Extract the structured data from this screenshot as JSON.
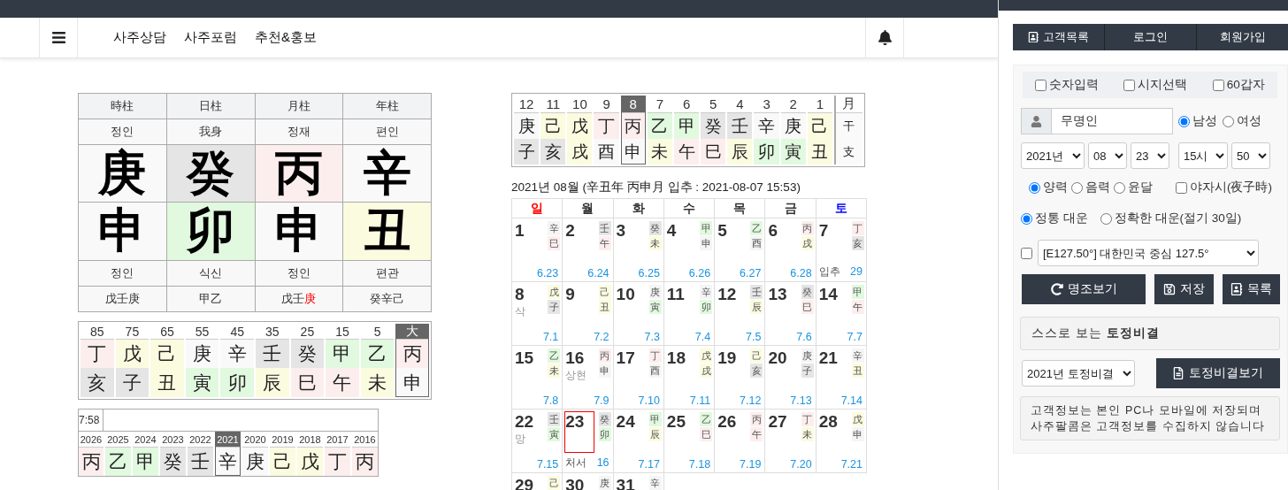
{
  "navbar": {
    "menu": [
      "사주상담",
      "사주포럼",
      "추천&홍보"
    ]
  },
  "pillars": {
    "columns": [
      {
        "title": "時柱",
        "top_role": "정인",
        "stem": {
          "char": "庚",
          "color": "#f9f9f9"
        },
        "branch": {
          "char": "申",
          "color": "#f9f9f9"
        },
        "bottom_role": "정인",
        "hidden": [
          {
            "text": "戊壬庚",
            "emphasis": false
          }
        ]
      },
      {
        "title": "日柱",
        "top_role": "我身",
        "stem": {
          "char": "癸",
          "color": "#e5e5e5"
        },
        "branch": {
          "char": "卯",
          "color": "#e1f9df"
        },
        "bottom_role": "식신",
        "hidden": [
          {
            "text": "甲乙",
            "emphasis": false
          }
        ]
      },
      {
        "title": "月柱",
        "top_role": "정재",
        "stem": {
          "char": "丙",
          "color": "#fdeeee"
        },
        "branch": {
          "char": "申",
          "color": "#f9f9f9"
        },
        "bottom_role": "정인",
        "hidden": [
          {
            "text": "戊壬",
            "emphasis": false
          },
          {
            "text": "庚",
            "emphasis": true
          }
        ]
      },
      {
        "title": "年柱",
        "top_role": "편인",
        "stem": {
          "char": "辛",
          "color": "#f9f9f9"
        },
        "branch": {
          "char": "丑",
          "color": "#fbfbe0"
        },
        "bottom_role": "편관",
        "hidden": [
          {
            "text": "癸辛己",
            "emphasis": false
          }
        ]
      }
    ]
  },
  "daewoon": [
    {
      "label": "85",
      "selected": false,
      "stem": {
        "char": "丁",
        "color": "#fdeeee"
      },
      "branch": {
        "char": "亥",
        "color": "#e5e5e5"
      }
    },
    {
      "label": "75",
      "selected": false,
      "stem": {
        "char": "戊",
        "color": "#fbfbe0"
      },
      "branch": {
        "char": "子",
        "color": "#e5e5e5"
      }
    },
    {
      "label": "65",
      "selected": false,
      "stem": {
        "char": "己",
        "color": "#fbfbe0"
      },
      "branch": {
        "char": "丑",
        "color": "#fbfbe0"
      }
    },
    {
      "label": "55",
      "selected": false,
      "stem": {
        "char": "庚",
        "color": "#f9f9f9"
      },
      "branch": {
        "char": "寅",
        "color": "#e1f9df"
      }
    },
    {
      "label": "45",
      "selected": false,
      "stem": {
        "char": "辛",
        "color": "#f9f9f9"
      },
      "branch": {
        "char": "卯",
        "color": "#e1f9df"
      }
    },
    {
      "label": "35",
      "selected": false,
      "stem": {
        "char": "壬",
        "color": "#e5e5e5"
      },
      "branch": {
        "char": "辰",
        "color": "#fbfbe0"
      }
    },
    {
      "label": "25",
      "selected": false,
      "stem": {
        "char": "癸",
        "color": "#e5e5e5"
      },
      "branch": {
        "char": "巳",
        "color": "#fdeeee"
      }
    },
    {
      "label": "15",
      "selected": false,
      "stem": {
        "char": "甲",
        "color": "#e1f9df"
      },
      "branch": {
        "char": "午",
        "color": "#fdeeee"
      }
    },
    {
      "label": "5",
      "selected": false,
      "stem": {
        "char": "乙",
        "color": "#e1f9df"
      },
      "branch": {
        "char": "未",
        "color": "#fbfbe0"
      }
    },
    {
      "label": "大",
      "selected": true,
      "stem": {
        "char": "丙",
        "color": "#fdeeee"
      },
      "branch": {
        "char": "申",
        "color": "#f9f9f9"
      }
    }
  ],
  "years": {
    "time": "7:58",
    "items": [
      {
        "label": "2026",
        "selected": false,
        "stem": {
          "char": "丙",
          "color": "#fdeeee"
        }
      },
      {
        "label": "2025",
        "selected": false,
        "stem": {
          "char": "乙",
          "color": "#e1f9df"
        }
      },
      {
        "label": "2024",
        "selected": false,
        "stem": {
          "char": "甲",
          "color": "#e1f9df"
        }
      },
      {
        "label": "2023",
        "selected": false,
        "stem": {
          "char": "癸",
          "color": "#e5e5e5"
        }
      },
      {
        "label": "2022",
        "selected": false,
        "stem": {
          "char": "壬",
          "color": "#e5e5e5"
        }
      },
      {
        "label": "2021",
        "selected": true,
        "stem": {
          "char": "辛",
          "color": "#f9f9f9"
        }
      },
      {
        "label": "2020",
        "selected": false,
        "stem": {
          "char": "庚",
          "color": "#f9f9f9"
        }
      },
      {
        "label": "2019",
        "selected": false,
        "stem": {
          "char": "己",
          "color": "#fbfbe0"
        }
      },
      {
        "label": "2018",
        "selected": false,
        "stem": {
          "char": "戊",
          "color": "#fbfbe0"
        }
      },
      {
        "label": "2017",
        "selected": false,
        "stem": {
          "char": "丁",
          "color": "#fdeeee"
        }
      },
      {
        "label": "2016",
        "selected": false,
        "stem": {
          "char": "丙",
          "color": "#fdeeee"
        }
      }
    ]
  },
  "months": {
    "legend": {
      "label": "月",
      "stem": "干",
      "branch": "支"
    },
    "items": [
      {
        "label": "12",
        "selected": false,
        "stem": {
          "char": "庚",
          "color": "#f9f9f9"
        },
        "branch": {
          "char": "子",
          "color": "#e5e5e5"
        }
      },
      {
        "label": "11",
        "selected": false,
        "stem": {
          "char": "己",
          "color": "#fbfbe0"
        },
        "branch": {
          "char": "亥",
          "color": "#e5e5e5"
        }
      },
      {
        "label": "10",
        "selected": false,
        "stem": {
          "char": "戊",
          "color": "#fbfbe0"
        },
        "branch": {
          "char": "戌",
          "color": "#fbfbe0"
        }
      },
      {
        "label": "9",
        "selected": false,
        "stem": {
          "char": "丁",
          "color": "#fdeeee"
        },
        "branch": {
          "char": "酉",
          "color": "#f9f9f9"
        }
      },
      {
        "label": "8",
        "selected": true,
        "stem": {
          "char": "丙",
          "color": "#fdeeee"
        },
        "branch": {
          "char": "申",
          "color": "#f9f9f9"
        }
      },
      {
        "label": "7",
        "selected": false,
        "stem": {
          "char": "乙",
          "color": "#e1f9df"
        },
        "branch": {
          "char": "未",
          "color": "#fbfbe0"
        }
      },
      {
        "label": "6",
        "selected": false,
        "stem": {
          "char": "甲",
          "color": "#e1f9df"
        },
        "branch": {
          "char": "午",
          "color": "#fdeeee"
        }
      },
      {
        "label": "5",
        "selected": false,
        "stem": {
          "char": "癸",
          "color": "#e5e5e5"
        },
        "branch": {
          "char": "巳",
          "color": "#fdeeee"
        }
      },
      {
        "label": "4",
        "selected": false,
        "stem": {
          "char": "壬",
          "color": "#e5e5e5"
        },
        "branch": {
          "char": "辰",
          "color": "#fbfbe0"
        }
      },
      {
        "label": "3",
        "selected": false,
        "stem": {
          "char": "辛",
          "color": "#f9f9f9"
        },
        "branch": {
          "char": "卯",
          "color": "#e1f9df"
        }
      },
      {
        "label": "2",
        "selected": false,
        "stem": {
          "char": "庚",
          "color": "#f9f9f9"
        },
        "branch": {
          "char": "寅",
          "color": "#e1f9df"
        }
      },
      {
        "label": "1",
        "selected": false,
        "stem": {
          "char": "己",
          "color": "#fbfbe0"
        },
        "branch": {
          "char": "丑",
          "color": "#fbfbe0"
        }
      }
    ]
  },
  "calendar": {
    "title": "2021년 08월 (辛丑年 丙申月 입추 : 2021-08-07 15:53)",
    "weekdays": [
      {
        "label": "일",
        "color": "#ff0000"
      },
      {
        "label": "월",
        "color": "#333333"
      },
      {
        "label": "화",
        "color": "#333333"
      },
      {
        "label": "수",
        "color": "#333333"
      },
      {
        "label": "목",
        "color": "#333333"
      },
      {
        "label": "금",
        "color": "#333333"
      },
      {
        "label": "토",
        "color": "#0000ff"
      }
    ],
    "days": [
      {
        "day": "1",
        "selected": false,
        "stem": {
          "char": "辛",
          "color": "#f5f5f5"
        },
        "branch": {
          "char": "巳",
          "color": "#fdeeee"
        },
        "lunar": "6.23"
      },
      {
        "day": "2",
        "selected": false,
        "stem": {
          "char": "壬",
          "color": "#e5e5e5"
        },
        "branch": {
          "char": "午",
          "color": "#fdeeee"
        },
        "lunar": "6.24"
      },
      {
        "day": "3",
        "selected": false,
        "stem": {
          "char": "癸",
          "color": "#e5e5e5"
        },
        "branch": {
          "char": "未",
          "color": "#fbfbe0"
        },
        "lunar": "6.25"
      },
      {
        "day": "4",
        "selected": false,
        "stem": {
          "char": "甲",
          "color": "#e1f9df"
        },
        "branch": {
          "char": "申",
          "color": "#f5f5f5"
        },
        "lunar": "6.26"
      },
      {
        "day": "5",
        "selected": false,
        "stem": {
          "char": "乙",
          "color": "#e1f9df"
        },
        "branch": {
          "char": "酉",
          "color": "#f5f5f5"
        },
        "lunar": "6.27"
      },
      {
        "day": "6",
        "selected": false,
        "stem": {
          "char": "丙",
          "color": "#fdeeee"
        },
        "branch": {
          "char": "戌",
          "color": "#fbfbe0"
        },
        "lunar": "6.28"
      },
      {
        "day": "7",
        "selected": false,
        "stem": {
          "char": "丁",
          "color": "#fdeeee"
        },
        "branch": {
          "char": "亥",
          "color": "#e5e5e5"
        },
        "term": "입추",
        "lunar": "29"
      },
      {
        "day": "8",
        "selected": false,
        "stem": {
          "char": "戊",
          "color": "#fbfbe0"
        },
        "branch": {
          "char": "子",
          "color": "#e5e5e5"
        },
        "note": "삭",
        "lunar": "7.1"
      },
      {
        "day": "9",
        "selected": false,
        "stem": {
          "char": "己",
          "color": "#fbfbe0"
        },
        "branch": {
          "char": "丑",
          "color": "#fbfbe0"
        },
        "lunar": "7.2"
      },
      {
        "day": "10",
        "selected": false,
        "stem": {
          "char": "庚",
          "color": "#f5f5f5"
        },
        "branch": {
          "char": "寅",
          "color": "#e1f9df"
        },
        "lunar": "7.3"
      },
      {
        "day": "11",
        "selected": false,
        "stem": {
          "char": "辛",
          "color": "#f5f5f5"
        },
        "branch": {
          "char": "卯",
          "color": "#e1f9df"
        },
        "lunar": "7.4"
      },
      {
        "day": "12",
        "selected": false,
        "stem": {
          "char": "壬",
          "color": "#e5e5e5"
        },
        "branch": {
          "char": "辰",
          "color": "#fbfbe0"
        },
        "lunar": "7.5"
      },
      {
        "day": "13",
        "selected": false,
        "stem": {
          "char": "癸",
          "color": "#e5e5e5"
        },
        "branch": {
          "char": "巳",
          "color": "#fdeeee"
        },
        "lunar": "7.6"
      },
      {
        "day": "14",
        "selected": false,
        "stem": {
          "char": "甲",
          "color": "#e1f9df"
        },
        "branch": {
          "char": "午",
          "color": "#fdeeee"
        },
        "lunar": "7.7"
      },
      {
        "day": "15",
        "selected": false,
        "stem": {
          "char": "乙",
          "color": "#e1f9df"
        },
        "branch": {
          "char": "未",
          "color": "#fbfbe0"
        },
        "lunar": "7.8"
      },
      {
        "day": "16",
        "selected": false,
        "stem": {
          "char": "丙",
          "color": "#fdeeee"
        },
        "branch": {
          "char": "申",
          "color": "#f5f5f5"
        },
        "note": "상현",
        "lunar": "7.9"
      },
      {
        "day": "17",
        "selected": false,
        "stem": {
          "char": "丁",
          "color": "#fdeeee"
        },
        "branch": {
          "char": "酉",
          "color": "#f5f5f5"
        },
        "lunar": "7.10"
      },
      {
        "day": "18",
        "selected": false,
        "stem": {
          "char": "戊",
          "color": "#fbfbe0"
        },
        "branch": {
          "char": "戌",
          "color": "#fbfbe0"
        },
        "lunar": "7.11"
      },
      {
        "day": "19",
        "selected": false,
        "stem": {
          "char": "己",
          "color": "#fbfbe0"
        },
        "branch": {
          "char": "亥",
          "color": "#e5e5e5"
        },
        "lunar": "7.12"
      },
      {
        "day": "20",
        "selected": false,
        "stem": {
          "char": "庚",
          "color": "#f5f5f5"
        },
        "branch": {
          "char": "子",
          "color": "#e5e5e5"
        },
        "lunar": "7.13"
      },
      {
        "day": "21",
        "selected": false,
        "stem": {
          "char": "辛",
          "color": "#f5f5f5"
        },
        "branch": {
          "char": "丑",
          "color": "#fbfbe0"
        },
        "lunar": "7.14"
      },
      {
        "day": "22",
        "selected": false,
        "stem": {
          "char": "壬",
          "color": "#e5e5e5"
        },
        "branch": {
          "char": "寅",
          "color": "#e1f9df"
        },
        "note": "망",
        "lunar": "7.15"
      },
      {
        "day": "23",
        "selected": true,
        "stem": {
          "char": "癸",
          "color": "#e5e5e5"
        },
        "branch": {
          "char": "卯",
          "color": "#e1f9df"
        },
        "term": "처서",
        "lunar": "16"
      },
      {
        "day": "24",
        "selected": false,
        "stem": {
          "char": "甲",
          "color": "#e1f9df"
        },
        "branch": {
          "char": "辰",
          "color": "#fbfbe0"
        },
        "lunar": "7.17"
      },
      {
        "day": "25",
        "selected": false,
        "stem": {
          "char": "乙",
          "color": "#e1f9df"
        },
        "branch": {
          "char": "巳",
          "color": "#fdeeee"
        },
        "lunar": "7.18"
      },
      {
        "day": "26",
        "selected": false,
        "stem": {
          "char": "丙",
          "color": "#fdeeee"
        },
        "branch": {
          "char": "午",
          "color": "#fdeeee"
        },
        "lunar": "7.19"
      },
      {
        "day": "27",
        "selected": false,
        "stem": {
          "char": "丁",
          "color": "#fdeeee"
        },
        "branch": {
          "char": "未",
          "color": "#fbfbe0"
        },
        "lunar": "7.20"
      },
      {
        "day": "28",
        "selected": false,
        "stem": {
          "char": "戊",
          "color": "#fbfbe0"
        },
        "branch": {
          "char": "申",
          "color": "#f5f5f5"
        },
        "lunar": "7.21"
      },
      {
        "day": "29",
        "selected": false,
        "stem": {
          "char": "己",
          "color": "#fbfbe0"
        }
      },
      {
        "day": "30",
        "selected": false,
        "stem": {
          "char": "庚",
          "color": "#f5f5f5"
        }
      },
      {
        "day": "31",
        "selected": false,
        "stem": {
          "char": "辛",
          "color": "#f5f5f5"
        }
      }
    ]
  },
  "side": {
    "top_buttons": [
      "고객목록",
      "로그인",
      "회원가입"
    ],
    "options": [
      {
        "label": "숫자입력",
        "checked": false
      },
      {
        "label": "시지선택",
        "checked": false
      },
      {
        "label": "60갑자",
        "checked": false
      }
    ],
    "name": {
      "value": "무명인"
    },
    "gender": [
      {
        "label": "남성",
        "selected": true
      },
      {
        "label": "여성",
        "selected": false
      }
    ],
    "date_selects": [
      "2021년",
      "08",
      "23",
      "15시",
      "50"
    ],
    "calendar_type": [
      {
        "label": "양력",
        "selected": true
      },
      {
        "label": "음력",
        "selected": false
      },
      {
        "label": "윤달",
        "selected": false
      }
    ],
    "night_hour": {
      "label": "야자시(夜子時)",
      "checked": false
    },
    "daewoon_mode": [
      {
        "label": "정통 대운",
        "selected": true
      },
      {
        "label": "정확한 대운(절기 30일)",
        "selected": false
      }
    ],
    "location": {
      "checked": false,
      "value": "[E127.50°] 대한민국 중심 127.5°"
    },
    "actions": [
      "명조보기",
      "저장",
      "목록"
    ],
    "tojung_heading": "스스로 보는 **토정비결**",
    "tojung_select": "2021년 토정비결",
    "tojung_button": "토정비결보기",
    "notice": [
      "고객정보는 본인 PC나 모바일에 저장되며",
      "사주팔콤은 고객정보를 수집하지 않습니다"
    ]
  }
}
